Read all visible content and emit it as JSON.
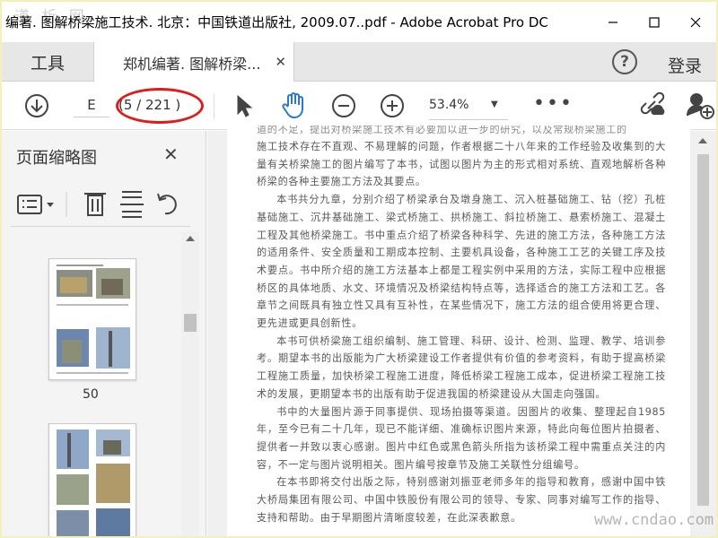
{
  "window": {
    "title": "编著. 图解桥梁施工技术. 北京：中国铁道出版社, 2009.07..pdf - Adobe Acrobat Pro DC",
    "watermark_top": "道 析 网"
  },
  "tabs": {
    "tools_label": "工具",
    "document_label": "郑机编著. 图解桥梁...",
    "close_glyph": "✕"
  },
  "header_right": {
    "help_glyph": "?",
    "login_label": "登录"
  },
  "toolbar": {
    "page_input_value": "E",
    "page_count": "(5 / 221 )",
    "zoom_value": "53.4%",
    "zoom_arrow": "▼",
    "more_glyph": "•••"
  },
  "left_pane": {
    "title": "页面缩略图",
    "close_glyph": "✕",
    "thumbnail_label": "50"
  },
  "document": {
    "paragraphs": [
      "施工技术存在不直观、不易理解的问题，作者根据二十八年来的工作经验及收集到的大量有关桥梁施工的图片编写了本书，试图以图片为主的形式相对系统、直观地解析各种桥梁的各种主要施工方法及其要点。",
      "本书共分九章，分别介绍了桥梁承台及墩身施工、沉入桩基础施工、钻（挖）孔桩基础施工、沉井基础施工、梁式桥施工、拱桥施工、斜拉桥施工、悬索桥施工、混凝土工程及其他桥梁施工。书中重点介绍了桥梁各种科学、先进的施工方法，各种施工方法的适用条件、安全质量和工期成本控制、主要机具设备，各种施工工艺的关键工序及技术要点。书中所介绍的施工方法基本上都是工程实例中采用的方法，实际工程中应根据桥区的具体地质、水文、环境情况及桥梁结构特点等，选择适合的施工方法和工艺。各章节之间既具有独立性又具有互补性，在某些情况下，施工方法的组合使用将更合理、更先进或更具创新性。",
      "本书可供桥梁施工组织编制、施工管理、科研、设计、检测、监理、教学、培训参考。期望本书的出版能为广大桥梁建设工作者提供有价值的参考资料，有助于提高桥梁工程施工质量，加快桥梁工程施工进度，降低桥梁工程施工成本，促进桥梁工程施工技术的发展，更期望本书的出版有助于促进我国的桥梁建设从大国走向强国。",
      "书中的大量图片源于同事提供、现场拍摄等渠道。因图片的收集、整理起自1985 年，至今已有二十几年，现已不能详细、准确标识图片来源，特此向每位图片拍摄者、提供者一并致以衷心感谢。图片中红色或黑色箭头所指为该桥梁工程中需重点关注的内容，不一定与图片说明相关。图片编号按章节及施工关联性分组编号。",
      "在本书即将交付出版之际，特别感谢刘振亚老师多年的指导和教育，感谢中国中铁大桥局集团有限公司、中国中铁股份有限公司的领导、专家、同事对编写工作的指导、支持和帮助。由于早期图片清晰度较差，在此深表歉意。"
    ],
    "top_cut_line": "道的不足，提出对桥梁施工技术有必要加以进一步的研究，以及常规桥梁施工的"
  },
  "watermark_bottom": "www.cndao.com",
  "colors": {
    "highlight_ellipse": "#e01b1b",
    "window_border": "#f2f2b8",
    "document_text": "#595959"
  }
}
